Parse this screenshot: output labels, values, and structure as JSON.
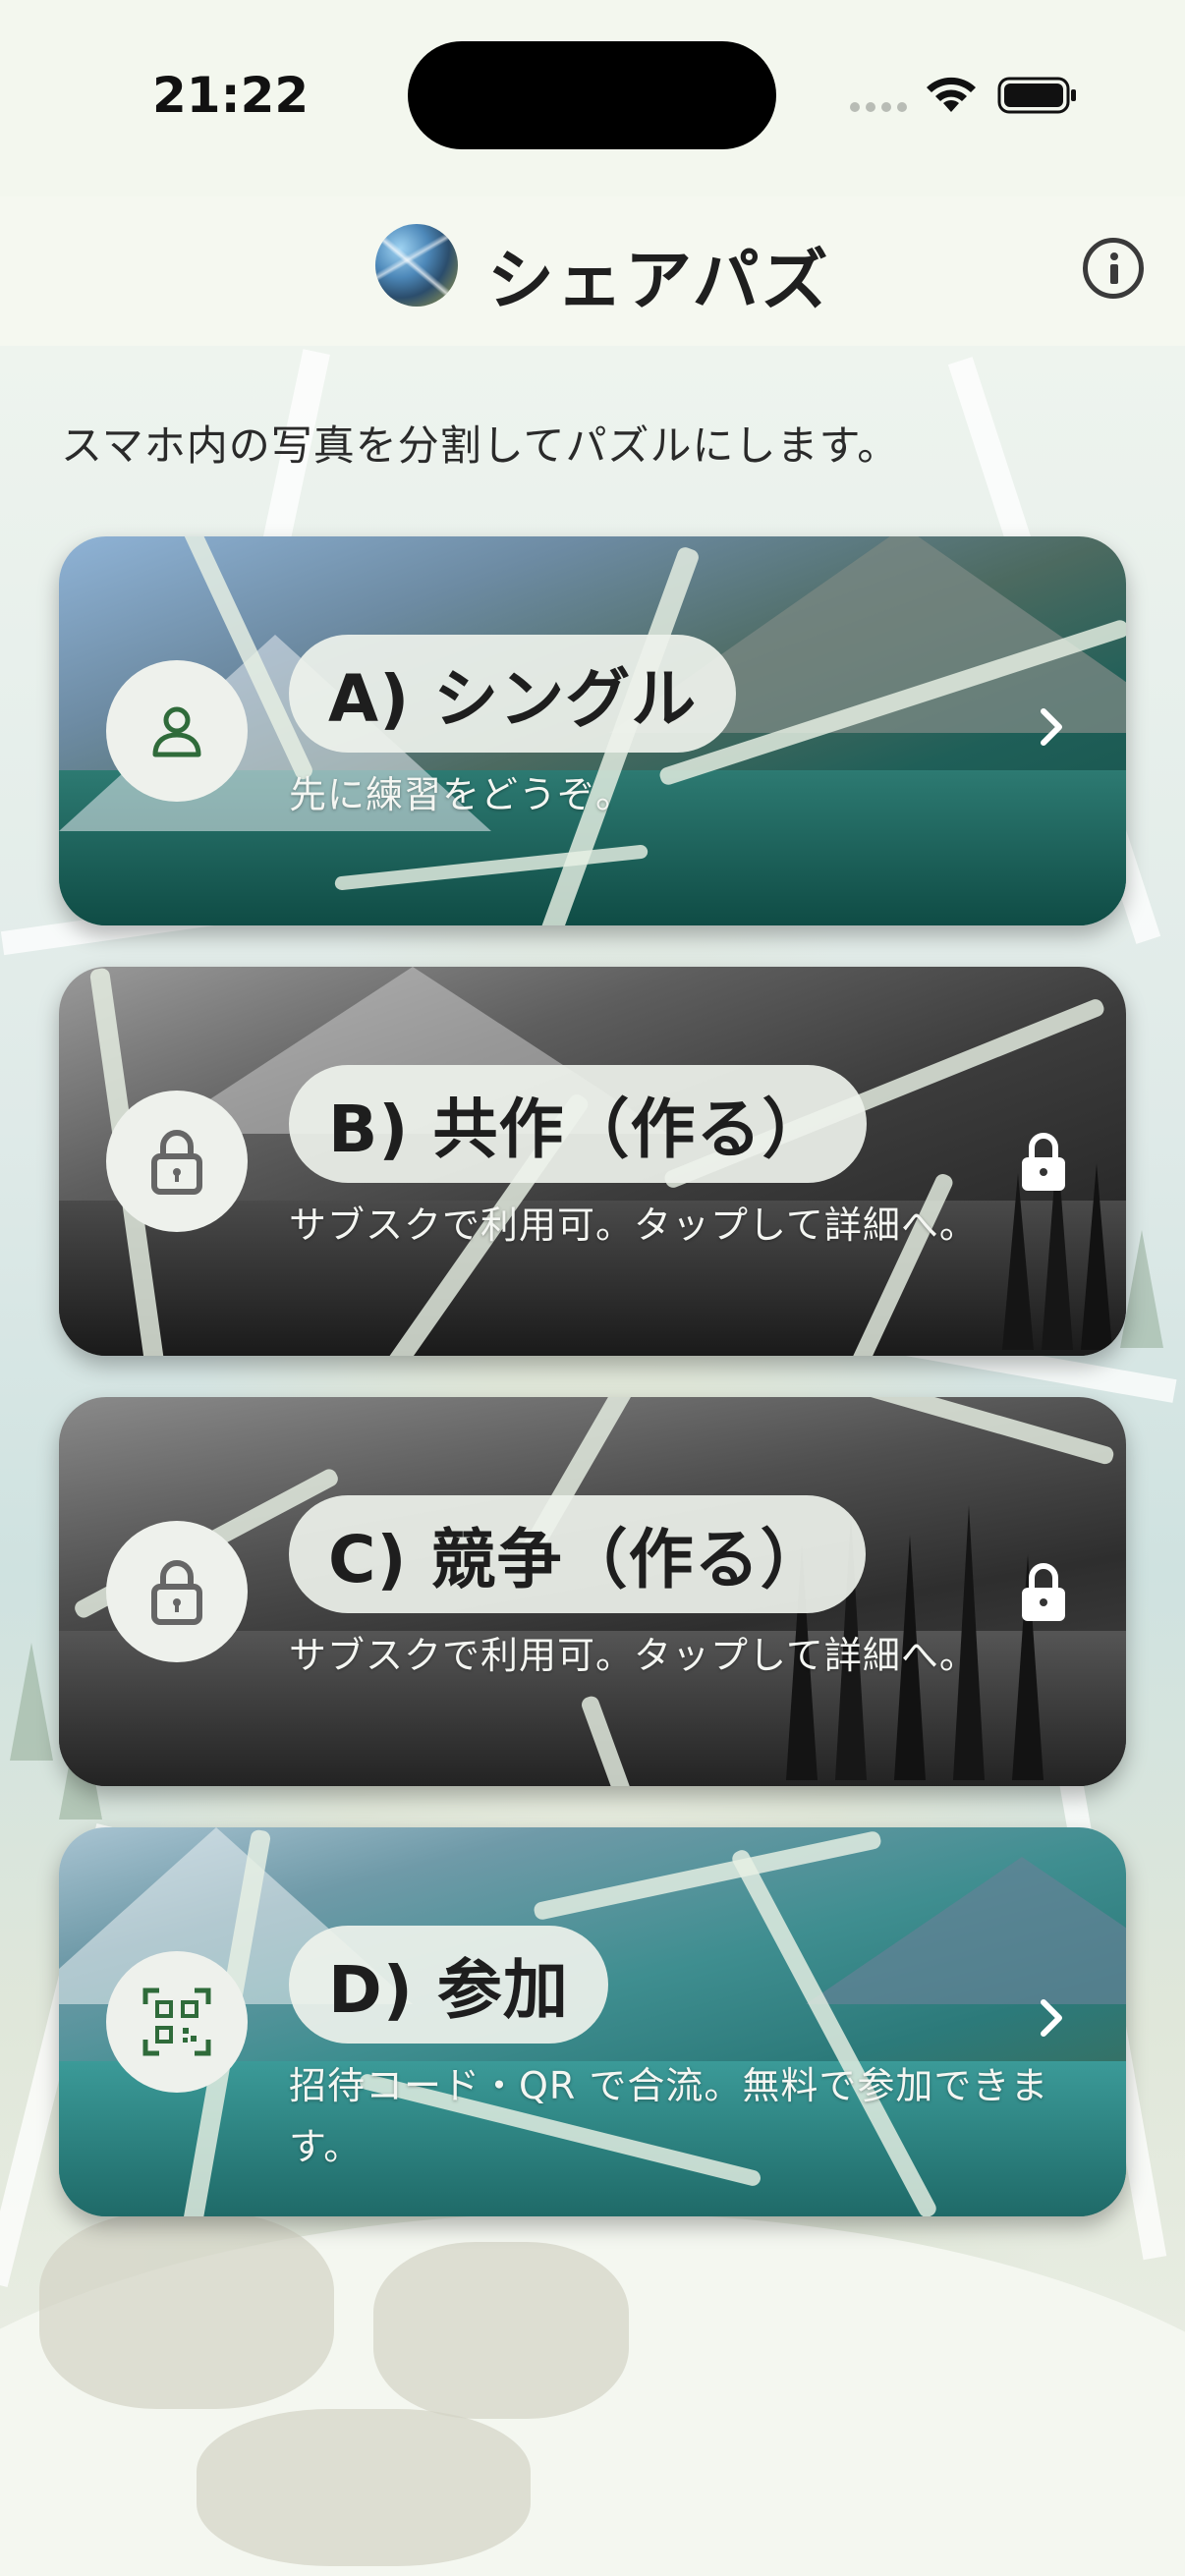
{
  "status_bar": {
    "time": "21:22"
  },
  "header": {
    "title": "シェアパズ"
  },
  "intro": "スマホ内の写真を分割してパズルにします。",
  "cards": [
    {
      "title": "A) シングル",
      "subtitle": "先に練習をどうぞ。",
      "icon": "person-icon",
      "trailing": "chevron-right-icon",
      "locked": false
    },
    {
      "title": "B) 共作（作る）",
      "subtitle": "サブスクで利用可。タップして詳細へ。",
      "icon": "lock-icon",
      "trailing": "lock-icon",
      "locked": true
    },
    {
      "title": "C) 競争（作る）",
      "subtitle": "サブスクで利用可。タップして詳細へ。",
      "icon": "lock-icon",
      "trailing": "lock-icon",
      "locked": true
    },
    {
      "title": "D) 参加",
      "subtitle": "招待コード・QR で合流。無料で参加できます。",
      "icon": "qr-scan-icon",
      "trailing": "chevron-right-icon",
      "locked": false
    }
  ],
  "colors": {
    "accent_green": "#2f6b3a",
    "background": "#f3f7ee",
    "pill": "#eef2ec"
  }
}
